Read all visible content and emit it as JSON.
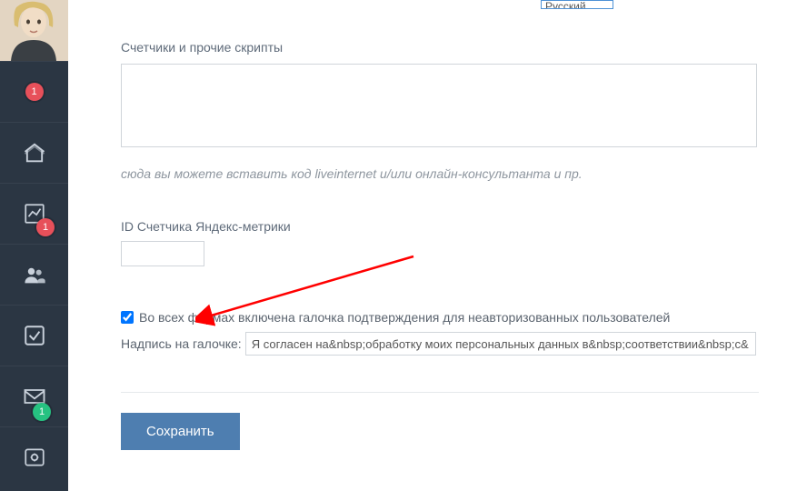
{
  "sidebar": {
    "badges": {
      "avatar": "1",
      "chart": "1",
      "mail": "1"
    }
  },
  "form": {
    "lang_select_visible": "Русский",
    "scripts_label": "Счетчики и прочие скрипты",
    "scripts_value": "",
    "scripts_hint": "сюда вы можете вставить код liveinternet и/или онлайн-консультанта и пр.",
    "metrika_label": "ID Счетчика Яндекс-метрики",
    "metrika_value": "",
    "consent_checked": true,
    "consent_label": "Во всех формах включена галочка подтверждения для неавторизованных пользователей",
    "consent_text_label": "Надпись на галочке:",
    "consent_text_value": "Я согласен на&nbsp;обработку моих персональных данных в&nbsp;соответствии&nbsp;с&",
    "save_label": "Сохранить"
  }
}
